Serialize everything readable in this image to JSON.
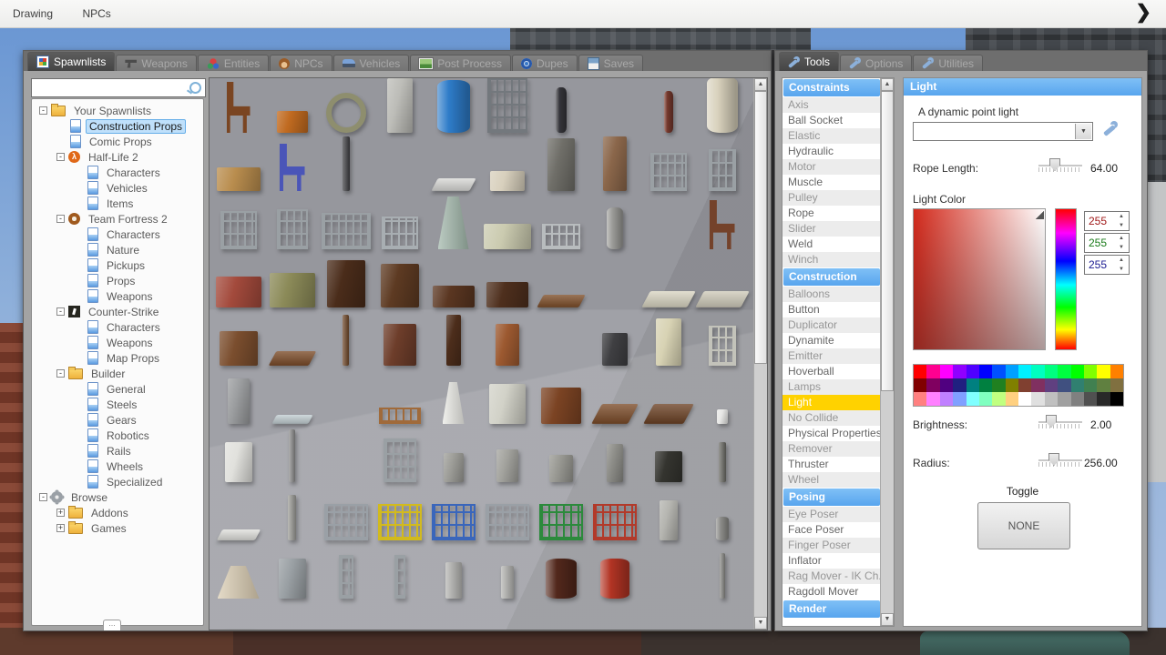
{
  "menubar": {
    "items": [
      {
        "label": "Drawing"
      },
      {
        "label": "NPCs"
      }
    ],
    "chevron": "❯"
  },
  "spawn_window": {
    "tabs": [
      {
        "label": "Spawnlists",
        "icon": "grid",
        "active": true
      },
      {
        "label": "Weapons",
        "icon": "gun",
        "active": false
      },
      {
        "label": "Entities",
        "icon": "cubes",
        "active": false
      },
      {
        "label": "NPCs",
        "icon": "monkey",
        "active": false
      },
      {
        "label": "Vehicles",
        "icon": "car",
        "active": false
      },
      {
        "label": "Post Process",
        "icon": "image",
        "active": false
      },
      {
        "label": "Dupes",
        "icon": "dupe",
        "active": false
      },
      {
        "label": "Saves",
        "icon": "save",
        "active": false
      }
    ],
    "search": {
      "value": "",
      "placeholder": ""
    },
    "tree": [
      {
        "depth": 0,
        "icon": "folder",
        "label": "Your Spawnlists",
        "expander": "-",
        "selected": false
      },
      {
        "depth": 1,
        "icon": "page",
        "label": "Construction Props",
        "expander": "",
        "selected": true
      },
      {
        "depth": 1,
        "icon": "page",
        "label": "Comic Props",
        "expander": "",
        "selected": false
      },
      {
        "depth": 1,
        "icon": "hl2",
        "label": "Half-Life 2",
        "expander": "-",
        "selected": false
      },
      {
        "depth": 2,
        "icon": "page",
        "label": "Characters",
        "expander": "",
        "selected": false
      },
      {
        "depth": 2,
        "icon": "page",
        "label": "Vehicles",
        "expander": "",
        "selected": false
      },
      {
        "depth": 2,
        "icon": "page",
        "label": "Items",
        "expander": "",
        "selected": false
      },
      {
        "depth": 1,
        "icon": "tf2",
        "label": "Team Fortress 2",
        "expander": "-",
        "selected": false
      },
      {
        "depth": 2,
        "icon": "page",
        "label": "Characters",
        "expander": "",
        "selected": false
      },
      {
        "depth": 2,
        "icon": "page",
        "label": "Nature",
        "expander": "",
        "selected": false
      },
      {
        "depth": 2,
        "icon": "page",
        "label": "Pickups",
        "expander": "",
        "selected": false
      },
      {
        "depth": 2,
        "icon": "page",
        "label": "Props",
        "expander": "",
        "selected": false
      },
      {
        "depth": 2,
        "icon": "page",
        "label": "Weapons",
        "expander": "",
        "selected": false
      },
      {
        "depth": 1,
        "icon": "cs",
        "label": "Counter-Strike",
        "expander": "-",
        "selected": false
      },
      {
        "depth": 2,
        "icon": "page",
        "label": "Characters",
        "expander": "",
        "selected": false
      },
      {
        "depth": 2,
        "icon": "page",
        "label": "Weapons",
        "expander": "",
        "selected": false
      },
      {
        "depth": 2,
        "icon": "page",
        "label": "Map Props",
        "expander": "",
        "selected": false
      },
      {
        "depth": 1,
        "icon": "folder",
        "label": "Builder",
        "expander": "-",
        "selected": false
      },
      {
        "depth": 2,
        "icon": "page",
        "label": "General",
        "expander": "",
        "selected": false
      },
      {
        "depth": 2,
        "icon": "page",
        "label": "Steels",
        "expander": "",
        "selected": false
      },
      {
        "depth": 2,
        "icon": "page",
        "label": "Gears",
        "expander": "",
        "selected": false
      },
      {
        "depth": 2,
        "icon": "page",
        "label": "Robotics",
        "expander": "",
        "selected": false
      },
      {
        "depth": 2,
        "icon": "page",
        "label": "Rails",
        "expander": "",
        "selected": false
      },
      {
        "depth": 2,
        "icon": "page",
        "label": "Wheels",
        "expander": "",
        "selected": false
      },
      {
        "depth": 2,
        "icon": "page",
        "label": "Specialized",
        "expander": "",
        "selected": false
      },
      {
        "depth": 0,
        "icon": "gear",
        "label": "Browse",
        "expander": "-",
        "selected": false
      },
      {
        "depth": 1,
        "icon": "folder",
        "label": "Addons",
        "expander": "+",
        "selected": false
      },
      {
        "depth": 1,
        "icon": "folder",
        "label": "Games",
        "expander": "+",
        "selected": false
      }
    ],
    "grip_label": "..."
  },
  "props_grid": {
    "rows": [
      [
        {
          "t": "chair",
          "c": "#7a4522",
          "w": 26,
          "h": 56
        },
        {
          "t": "box",
          "c": "#c06a20",
          "w": 34,
          "h": 24
        },
        {
          "t": "ring",
          "c": "#8e8e6e",
          "w": 44,
          "h": 44
        },
        {
          "t": "box",
          "c": "#bdbdb8",
          "w": 28,
          "h": 60
        },
        {
          "t": "cyl",
          "c": "#2e7cc9",
          "w": 36,
          "h": 58
        },
        {
          "t": "bars",
          "c": "#73787d",
          "w": 44,
          "h": 60
        },
        {
          "t": "cyl",
          "c": "#35353a",
          "w": 12,
          "h": 50
        },
        null,
        {
          "t": "cyl",
          "c": "#74382c",
          "w": 10,
          "h": 46
        },
        {
          "t": "cyl",
          "c": "#d9d2bd",
          "w": 34,
          "h": 62
        }
      ],
      [
        {
          "t": "box",
          "c": "#b98d4e",
          "w": 48,
          "h": 26
        },
        {
          "t": "chair",
          "c": "#4a55b8",
          "w": 28,
          "h": 52
        },
        {
          "t": "thin",
          "c": "#3c3c40",
          "w": 8,
          "h": 60
        },
        null,
        {
          "t": "flat",
          "c": "#d9d9d6",
          "w": 42,
          "h": 14
        },
        {
          "t": "box",
          "c": "#d8d0bd",
          "w": 38,
          "h": 22
        },
        {
          "t": "box",
          "c": "#6f6e68",
          "w": 30,
          "h": 58
        },
        {
          "t": "box",
          "c": "#8a664a",
          "w": 26,
          "h": 60
        },
        {
          "t": "bars",
          "c": "#9aa0a4",
          "w": 40,
          "h": 42
        },
        {
          "t": "bars",
          "c": "#9aa0a4",
          "w": 30,
          "h": 46
        }
      ],
      [
        {
          "t": "bars",
          "c": "#9aa0a4",
          "w": 40,
          "h": 42
        },
        {
          "t": "bars",
          "c": "#9aa0a4",
          "w": 34,
          "h": 44
        },
        {
          "t": "bars",
          "c": "#9aa0a4",
          "w": 54,
          "h": 40
        },
        {
          "t": "bars",
          "c": "#a8aeb2",
          "w": 40,
          "h": 36
        },
        {
          "t": "cone",
          "c": "#9fb5a8",
          "w": 34,
          "h": 58
        },
        {
          "t": "box",
          "c": "#cbcbb0",
          "w": 52,
          "h": 28
        },
        {
          "t": "bars",
          "c": "#b8bcbe",
          "w": 42,
          "h": 28
        },
        {
          "t": "cyl",
          "c": "#9b9b98",
          "w": 18,
          "h": 46
        },
        null,
        {
          "t": "chair",
          "c": "#74422a",
          "w": 28,
          "h": 54
        }
      ],
      [
        {
          "t": "box",
          "c": "#a34a3c",
          "w": 50,
          "h": 34
        },
        {
          "t": "box",
          "c": "#8b8a58",
          "w": 50,
          "h": 38
        },
        {
          "t": "box",
          "c": "#4a2c1a",
          "w": 42,
          "h": 52
        },
        {
          "t": "box",
          "c": "#5d3a22",
          "w": 42,
          "h": 48
        },
        {
          "t": "box",
          "c": "#5a3621",
          "w": 46,
          "h": 24
        },
        {
          "t": "box",
          "c": "#4e2f1d",
          "w": 46,
          "h": 28
        },
        {
          "t": "flat",
          "c": "#7d4d28",
          "w": 46,
          "h": 14
        },
        null,
        {
          "t": "flat",
          "c": "#d9d5c2",
          "w": 50,
          "h": 18
        },
        {
          "t": "flat",
          "c": "#cfcbba",
          "w": 50,
          "h": 18
        }
      ],
      [
        {
          "t": "box",
          "c": "#7b4e2e",
          "w": 42,
          "h": 38
        },
        {
          "t": "flat",
          "c": "#7b4b28",
          "w": 44,
          "h": 16
        },
        {
          "t": "thin",
          "c": "#6e4526",
          "w": 7,
          "h": 56
        },
        {
          "t": "box",
          "c": "#6d3d2a",
          "w": 36,
          "h": 46
        },
        {
          "t": "box",
          "c": "#4c2d1b",
          "w": 16,
          "h": 56
        },
        {
          "t": "box",
          "c": "#9c5930",
          "w": 26,
          "h": 46
        },
        null,
        {
          "t": "box",
          "c": "#3f3f42",
          "w": 28,
          "h": 36
        },
        {
          "t": "box",
          "c": "#d8d3b4",
          "w": 28,
          "h": 52
        },
        {
          "t": "bars",
          "c": "#c3c3ba",
          "w": 30,
          "h": 44
        }
      ],
      [
        {
          "t": "box",
          "c": "#9c9ea0",
          "w": 24,
          "h": 50
        },
        {
          "t": "flat",
          "c": "#c2ced2",
          "w": 40,
          "h": 10
        },
        null,
        {
          "t": "bars",
          "c": "#a06a3a",
          "w": 46,
          "h": 18
        },
        {
          "t": "cone",
          "c": "#e9e9e4",
          "w": 24,
          "h": 46
        },
        {
          "t": "box",
          "c": "#d2d2c8",
          "w": 40,
          "h": 44
        },
        {
          "t": "box",
          "c": "#7b4323",
          "w": 44,
          "h": 40
        },
        {
          "t": "flat",
          "c": "#7b4b28",
          "w": 40,
          "h": 22
        },
        {
          "t": "flat",
          "c": "#6b4124",
          "w": 44,
          "h": 22
        },
        {
          "t": "box",
          "c": "#e8e8e6",
          "w": 12,
          "h": 16
        }
      ],
      [
        {
          "t": "box",
          "c": "#e1e1dd",
          "w": 30,
          "h": 44
        },
        {
          "t": "thin",
          "c": "#8c8c8c",
          "w": 7,
          "h": 58
        },
        null,
        {
          "t": "bars",
          "c": "#9aa0a4",
          "w": 36,
          "h": 48
        },
        {
          "t": "box",
          "c": "#9d9d98",
          "w": 22,
          "h": 32
        },
        {
          "t": "box",
          "c": "#a3a39e",
          "w": 24,
          "h": 36
        },
        {
          "t": "box",
          "c": "#989892",
          "w": 26,
          "h": 30
        },
        {
          "t": "box",
          "c": "#8d8d88",
          "w": 18,
          "h": 42
        },
        {
          "t": "box",
          "c": "#34342f",
          "w": 30,
          "h": 34
        },
        {
          "t": "thin",
          "c": "#6a6a64",
          "w": 8,
          "h": 44
        }
      ],
      [
        {
          "t": "flat",
          "c": "#e0e0dc",
          "w": 42,
          "h": 12
        },
        {
          "t": "thin",
          "c": "#9b9b96",
          "w": 9,
          "h": 50
        },
        {
          "t": "bars",
          "c": "#9aa0a6",
          "w": 48,
          "h": 40
        },
        {
          "t": "bars",
          "c": "#d2ba1e",
          "w": 48,
          "h": 40
        },
        {
          "t": "bars",
          "c": "#3a66bb",
          "w": 48,
          "h": 40
        },
        {
          "t": "bars",
          "c": "#9aa0a6",
          "w": 48,
          "h": 40
        },
        {
          "t": "bars",
          "c": "#2c8a3c",
          "w": 48,
          "h": 40
        },
        {
          "t": "bars",
          "c": "#b23a2a",
          "w": 48,
          "h": 40
        },
        {
          "t": "box",
          "c": "#b5b5b0",
          "w": 20,
          "h": 44
        },
        {
          "t": "cyl",
          "c": "#8d8d8a",
          "w": 14,
          "h": 26
        }
      ],
      [
        {
          "t": "cone",
          "c": "#d9cbb0",
          "w": 46,
          "h": 36
        },
        {
          "t": "box",
          "c": "#9aa0a4",
          "w": 30,
          "h": 44
        },
        {
          "t": "bars",
          "c": "#9aa0a4",
          "w": 16,
          "h": 48
        },
        {
          "t": "bars",
          "c": "#9aa0a4",
          "w": 12,
          "h": 48
        },
        {
          "t": "thin",
          "c": "#b5b5b2",
          "w": 18,
          "h": 40
        },
        {
          "t": "thin",
          "c": "#b5b5b2",
          "w": 14,
          "h": 36
        },
        {
          "t": "cyl",
          "c": "#53281c",
          "w": 34,
          "h": 44
        },
        {
          "t": "cyl",
          "c": "#b23424",
          "w": 32,
          "h": 44
        },
        null,
        {
          "t": "thin",
          "c": "#8a8a86",
          "w": 6,
          "h": 50
        }
      ],
      [
        {
          "t": "box",
          "c": "#3a3a36",
          "w": 34,
          "h": 30
        },
        {
          "t": "flat",
          "c": "#7d4d28",
          "w": 46,
          "h": 20
        },
        {
          "t": "box",
          "c": "#6b4226",
          "w": 40,
          "h": 26
        },
        null,
        null,
        null,
        null,
        null,
        null,
        null
      ]
    ]
  },
  "tools_window": {
    "tabs": [
      {
        "label": "Tools",
        "icon": "wrench",
        "active": true
      },
      {
        "label": "Options",
        "icon": "wrench",
        "active": false
      },
      {
        "label": "Utilities",
        "icon": "wrench",
        "active": false
      }
    ],
    "sections": [
      {
        "header": "Constraints",
        "selected": "",
        "items": [
          "Axis",
          "Ball Socket",
          "Elastic",
          "Hydraulic",
          "Motor",
          "Muscle",
          "Pulley",
          "Rope",
          "Slider",
          "Weld",
          "Winch"
        ]
      },
      {
        "header": "Construction",
        "selected": "Light",
        "items": [
          "Balloons",
          "Button",
          "Duplicator",
          "Dynamite",
          "Emitter",
          "Hoverball",
          "Lamps",
          "Light",
          "No Collide",
          "Physical Properties",
          "Remover",
          "Thruster",
          "Wheel"
        ]
      },
      {
        "header": "Posing",
        "selected": "",
        "items": [
          "Eye Poser",
          "Face Poser",
          "Finger Poser",
          "Inflator",
          "Rag Mover - IK Ch...",
          "Ragdoll Mover"
        ]
      },
      {
        "header": "Render",
        "selected": "",
        "items": []
      }
    ]
  },
  "light_panel": {
    "title": "Light",
    "description": "A dynamic point light",
    "preset_dropdown_value": "",
    "rope_length_label": "Rope Length:",
    "rope_length_value": "64.00",
    "light_color_label": "Light Color",
    "rgb": [
      {
        "value": "255",
        "color": "#a01818"
      },
      {
        "value": "255",
        "color": "#187a18"
      },
      {
        "value": "255",
        "color": "#181890"
      }
    ],
    "palette": [
      "#ff0000",
      "#ff0090",
      "#ff00ff",
      "#9000ff",
      "#5000ff",
      "#0000ff",
      "#0050ff",
      "#00a0ff",
      "#00f0ff",
      "#00ffc0",
      "#00ff80",
      "#00ff40",
      "#00ff00",
      "#80ff00",
      "#ffff00",
      "#ff8000",
      "#800000",
      "#800060",
      "#500080",
      "#202080",
      "#008080",
      "#008040",
      "#208020",
      "#808000",
      "#804030",
      "#803060",
      "#604080",
      "#405080",
      "#308070",
      "#408050",
      "#608040",
      "#807040",
      "#ff8080",
      "#ff80ff",
      "#c080ff",
      "#80a0ff",
      "#80ffff",
      "#80ffc0",
      "#c0ff80",
      "#ffd080",
      "#ffffff",
      "#e0e0e0",
      "#c0c0c0",
      "#a0a0a0",
      "#808080",
      "#505050",
      "#282828",
      "#000000"
    ],
    "brightness_label": "Brightness:",
    "brightness_value": "2.00",
    "radius_label": "Radius:",
    "radius_value": "256.00",
    "toggle_label": "Toggle",
    "none_button_label": "NONE"
  }
}
